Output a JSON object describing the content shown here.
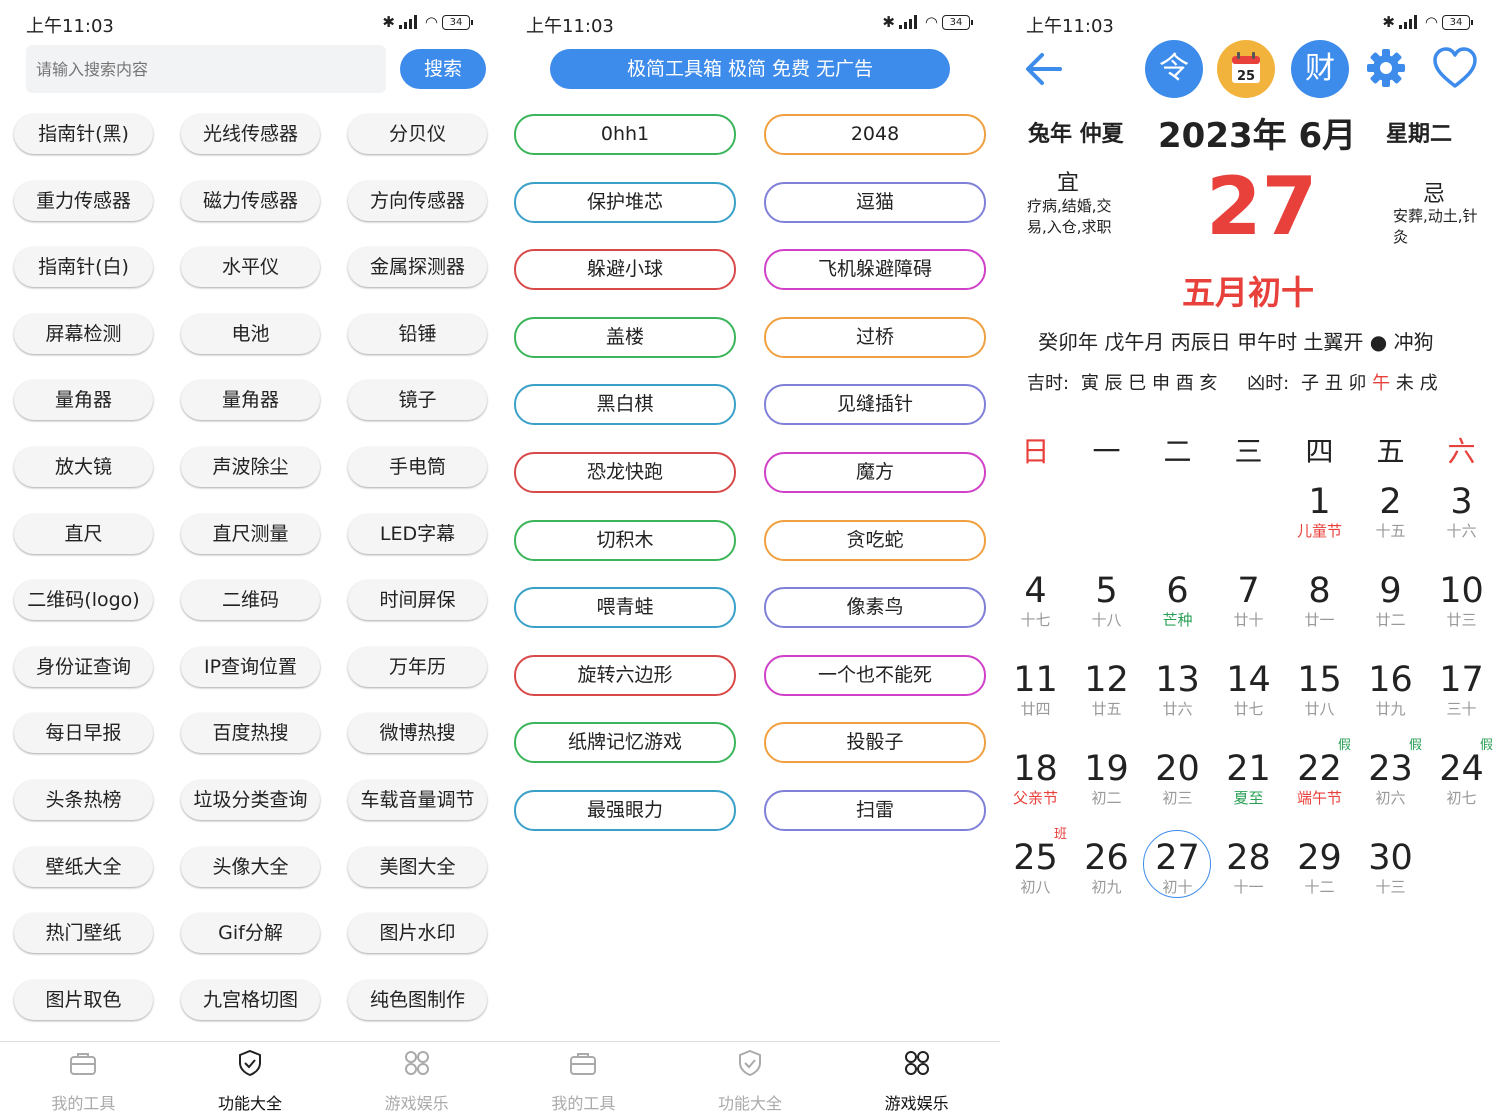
{
  "status": {
    "time": "上午11:03",
    "battery": "34"
  },
  "tools": {
    "search_placeholder": "请输入搜索内容",
    "search_label": "搜索",
    "items": [
      "指南针(黑)",
      "光线传感器",
      "分贝仪",
      "重力传感器",
      "磁力传感器",
      "方向传感器",
      "指南针(白)",
      "水平仪",
      "金属探测器",
      "屏幕检测",
      "电池",
      "铅锤",
      "量角器",
      "量角器",
      "镜子",
      "放大镜",
      "声波除尘",
      "手电筒",
      "直尺",
      "直尺测量",
      "LED字幕",
      "二维码(logo)",
      "二维码",
      "时间屏保",
      "身份证查询",
      "IP查询位置",
      "万年历",
      "每日早报",
      "百度热搜",
      "微博热搜",
      "头条热榜",
      "垃圾分类查询",
      "车载音量调节",
      "壁纸大全",
      "头像大全",
      "美图大全",
      "热门壁纸",
      "Gif分解",
      "图片水印",
      "图片取色",
      "九宫格切图",
      "纯色图制作"
    ]
  },
  "tabs": [
    {
      "label": "我的工具",
      "icon": "toolbox-icon"
    },
    {
      "label": "功能大全",
      "icon": "shield-check-icon"
    },
    {
      "label": "游戏娱乐",
      "icon": "grid-four-icon"
    }
  ],
  "games": {
    "banner": "极简工具箱 极简 免费 无广告",
    "items": [
      {
        "label": "0hh1",
        "color": "#3cb55a"
      },
      {
        "label": "2048",
        "color": "#f0a040"
      },
      {
        "label": "保护堆芯",
        "color": "#3aa0c8"
      },
      {
        "label": "逗猫",
        "color": "#8080d8"
      },
      {
        "label": "躲避小球",
        "color": "#d84a4a"
      },
      {
        "label": "飞机躲避障碍",
        "color": "#d040c8"
      },
      {
        "label": "盖楼",
        "color": "#3cb55a"
      },
      {
        "label": "过桥",
        "color": "#f0a040"
      },
      {
        "label": "黑白棋",
        "color": "#3aa0c8"
      },
      {
        "label": "见缝插针",
        "color": "#8080d8"
      },
      {
        "label": "恐龙快跑",
        "color": "#d84a4a"
      },
      {
        "label": "魔方",
        "color": "#d040c8"
      },
      {
        "label": "切积木",
        "color": "#3cb55a"
      },
      {
        "label": "贪吃蛇",
        "color": "#f0a040"
      },
      {
        "label": "喂青蛙",
        "color": "#3aa0c8"
      },
      {
        "label": "像素鸟",
        "color": "#8080d8"
      },
      {
        "label": "旋转六边形",
        "color": "#d84a4a"
      },
      {
        "label": "一个也不能死",
        "color": "#d040c8"
      },
      {
        "label": "纸牌记忆游戏",
        "color": "#3cb55a"
      },
      {
        "label": "投骰子",
        "color": "#f0a040"
      },
      {
        "label": "最强眼力",
        "color": "#3aa0c8"
      },
      {
        "label": "扫雷",
        "color": "#8080d8"
      }
    ]
  },
  "calendar": {
    "btn_ling": "令",
    "btn_cal_day": "25",
    "btn_cai": "财",
    "year_label": "兔年 仲夏",
    "year_month": "2023年 6月",
    "weekday": "星期二",
    "yi_title": "宜",
    "yi_content": "疗病,结婚,交易,入仓,求职",
    "ji_title": "忌",
    "ji_content": "安葬,动土,针灸",
    "big_day": "27",
    "lunar_date": "五月初十",
    "ganzhi": "癸卯年 戊午月 丙辰日 甲午时 土翼开 ● 冲狗",
    "ji_shi_label": "吉时:",
    "ji_shi": "寅 辰 巳 申 酉 亥",
    "xiong_shi_label": "凶时:",
    "xiong_shi_a": "子 丑 卯",
    "xiong_shi_red": "午",
    "xiong_shi_b": "未 戌",
    "weekdays": [
      "日",
      "一",
      "二",
      "三",
      "四",
      "五",
      "六"
    ],
    "days": [
      {
        "d": "1",
        "l": "儿童节",
        "lc": "red",
        "col": 4,
        "row": 0
      },
      {
        "d": "2",
        "l": "十五",
        "col": 5,
        "row": 0
      },
      {
        "d": "3",
        "l": "十六",
        "col": 6,
        "row": 0
      },
      {
        "d": "4",
        "l": "十七",
        "col": 0,
        "row": 1
      },
      {
        "d": "5",
        "l": "十八",
        "col": 1,
        "row": 1
      },
      {
        "d": "6",
        "l": "芒种",
        "lc": "green",
        "col": 2,
        "row": 1
      },
      {
        "d": "7",
        "l": "廿十",
        "col": 3,
        "row": 1
      },
      {
        "d": "8",
        "l": "廿一",
        "col": 4,
        "row": 1
      },
      {
        "d": "9",
        "l": "廿二",
        "col": 5,
        "row": 1
      },
      {
        "d": "10",
        "l": "廿三",
        "col": 6,
        "row": 1
      },
      {
        "d": "11",
        "l": "廿四",
        "col": 0,
        "row": 2
      },
      {
        "d": "12",
        "l": "廿五",
        "col": 1,
        "row": 2
      },
      {
        "d": "13",
        "l": "廿六",
        "col": 2,
        "row": 2
      },
      {
        "d": "14",
        "l": "廿七",
        "col": 3,
        "row": 2
      },
      {
        "d": "15",
        "l": "廿八",
        "col": 4,
        "row": 2
      },
      {
        "d": "16",
        "l": "廿九",
        "col": 5,
        "row": 2
      },
      {
        "d": "17",
        "l": "三十",
        "col": 6,
        "row": 2
      },
      {
        "d": "18",
        "l": "父亲节",
        "lc": "red",
        "col": 0,
        "row": 3
      },
      {
        "d": "19",
        "l": "初二",
        "col": 1,
        "row": 3
      },
      {
        "d": "20",
        "l": "初三",
        "col": 2,
        "row": 3
      },
      {
        "d": "21",
        "l": "夏至",
        "lc": "green",
        "col": 3,
        "row": 3
      },
      {
        "d": "22",
        "l": "端午节",
        "lc": "red",
        "mk": "假",
        "col": 4,
        "row": 3
      },
      {
        "d": "23",
        "l": "初六",
        "mk": "假",
        "col": 5,
        "row": 3
      },
      {
        "d": "24",
        "l": "初七",
        "mk": "假",
        "col": 6,
        "row": 3
      },
      {
        "d": "25",
        "l": "初八",
        "mk": "班",
        "mkc": "red",
        "col": 0,
        "row": 4
      },
      {
        "d": "26",
        "l": "初九",
        "col": 1,
        "row": 4
      },
      {
        "d": "27",
        "l": "初十",
        "today": true,
        "col": 2,
        "row": 4
      },
      {
        "d": "28",
        "l": "十一",
        "col": 3,
        "row": 4
      },
      {
        "d": "29",
        "l": "十二",
        "col": 4,
        "row": 4
      },
      {
        "d": "30",
        "l": "十三",
        "col": 5,
        "row": 4
      }
    ]
  },
  "colors": {
    "accent": "#3d8bea",
    "red": "#e8413c",
    "green": "#2aa055",
    "orange": "#f2b33d"
  }
}
